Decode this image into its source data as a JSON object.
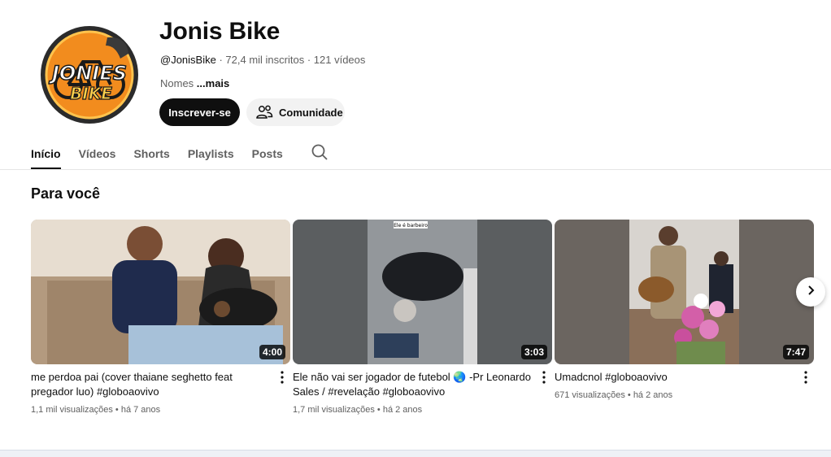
{
  "channel": {
    "name": "Jonis Bike",
    "handle": "@JonisBike",
    "subscribers": "72,4 mil inscritos",
    "video_count": "121 vídeos",
    "separator": " · ",
    "description": "Nomes ",
    "more_label": "...mais",
    "logo_text_line1": "JONIES",
    "logo_text_line2": "BIKE"
  },
  "actions": {
    "subscribe_label": "Inscrever-se",
    "community_label": "Comunidade"
  },
  "tabs": [
    {
      "label": "Início",
      "active": true
    },
    {
      "label": "Vídeos",
      "active": false
    },
    {
      "label": "Shorts",
      "active": false
    },
    {
      "label": "Playlists",
      "active": false
    },
    {
      "label": "Posts",
      "active": false
    }
  ],
  "section": {
    "title": "Para você"
  },
  "videos": [
    {
      "title": "me perdoa pai (cover thaiane seghetto feat pregador luo) #globoaovivo",
      "views": "1,1 mil visualizações",
      "age": "há 7 anos",
      "duration": "4:00"
    },
    {
      "title": "Ele não vai ser jogador de futebol 🌏 -Pr Leonardo Sales / #revelação #globoaovivo",
      "views": "1,7 mil visualizações",
      "age": "há 2 anos",
      "duration": "3:03",
      "thumb_caption": "Ele é barbeiro"
    },
    {
      "title": "Umadcnol #globoaovivo",
      "views": "671 visualizações",
      "age": "há 2 anos",
      "duration": "7:47"
    }
  ],
  "meta_separator": " • ",
  "icons": {
    "community": "people-icon",
    "search": "search-icon",
    "menu": "kebab-icon",
    "next": "chevron-right-icon"
  }
}
